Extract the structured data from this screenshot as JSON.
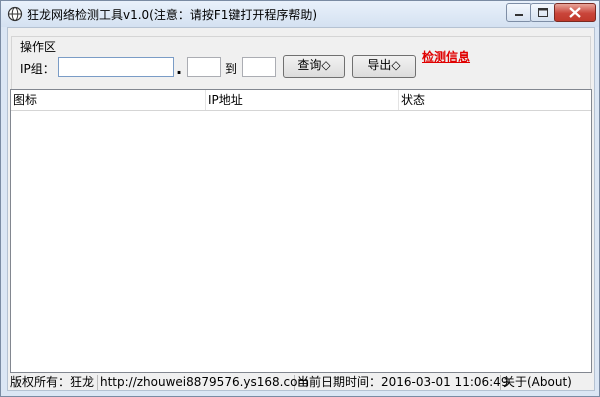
{
  "window": {
    "title": "狂龙网络检测工具v1.0(注意：请按F1键打开程序帮助)",
    "icon": "app-globe-icon"
  },
  "controls": {
    "group_label": "操作区",
    "ip_group_label": "IP组：",
    "ip_prefix_value": "",
    "dot": ".",
    "range_start_value": "",
    "to_label": "到",
    "range_end_value": "",
    "query_button": "查询◇",
    "export_button": "导出◇",
    "detect_info_link": "检测信息"
  },
  "list": {
    "columns": [
      "图标",
      "IP地址",
      "状态"
    ],
    "rows": []
  },
  "status": {
    "copyright": "版权所有：狂龙",
    "url": "http://zhouwei8879576.ys168.com",
    "datetime": "当前日期时间：2016-03-01 11:06:49",
    "about": "关于(About)"
  },
  "colors": {
    "close_button": "#c9453a",
    "link": "#e00000"
  }
}
